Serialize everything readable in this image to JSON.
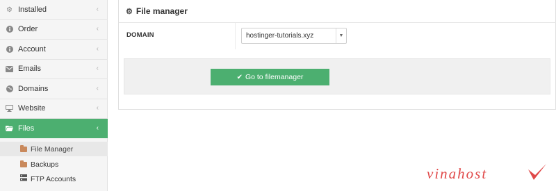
{
  "sidebar": {
    "items": [
      {
        "label": "Installed",
        "icon": "gear-icon"
      },
      {
        "label": "Order",
        "icon": "info-icon"
      },
      {
        "label": "Account",
        "icon": "info-icon"
      },
      {
        "label": "Emails",
        "icon": "envelope-icon"
      },
      {
        "label": "Domains",
        "icon": "globe-icon"
      },
      {
        "label": "Website",
        "icon": "monitor-icon"
      },
      {
        "label": "Files",
        "icon": "folder-open-icon"
      }
    ],
    "sub_items": [
      {
        "label": "File Manager",
        "icon": "folder-icon"
      },
      {
        "label": "Backups",
        "icon": "folder-icon"
      },
      {
        "label": "FTP Accounts",
        "icon": "server-icon"
      }
    ],
    "chevron": "‹",
    "active_color": "#4caf70"
  },
  "panel": {
    "title": "File manager",
    "domain_label": "DOMAIN",
    "domain_value": "hostinger-tutorials.xyz",
    "button_label": "Go to filemanager",
    "button_color": "#4caf70"
  },
  "watermark": "vinahost"
}
